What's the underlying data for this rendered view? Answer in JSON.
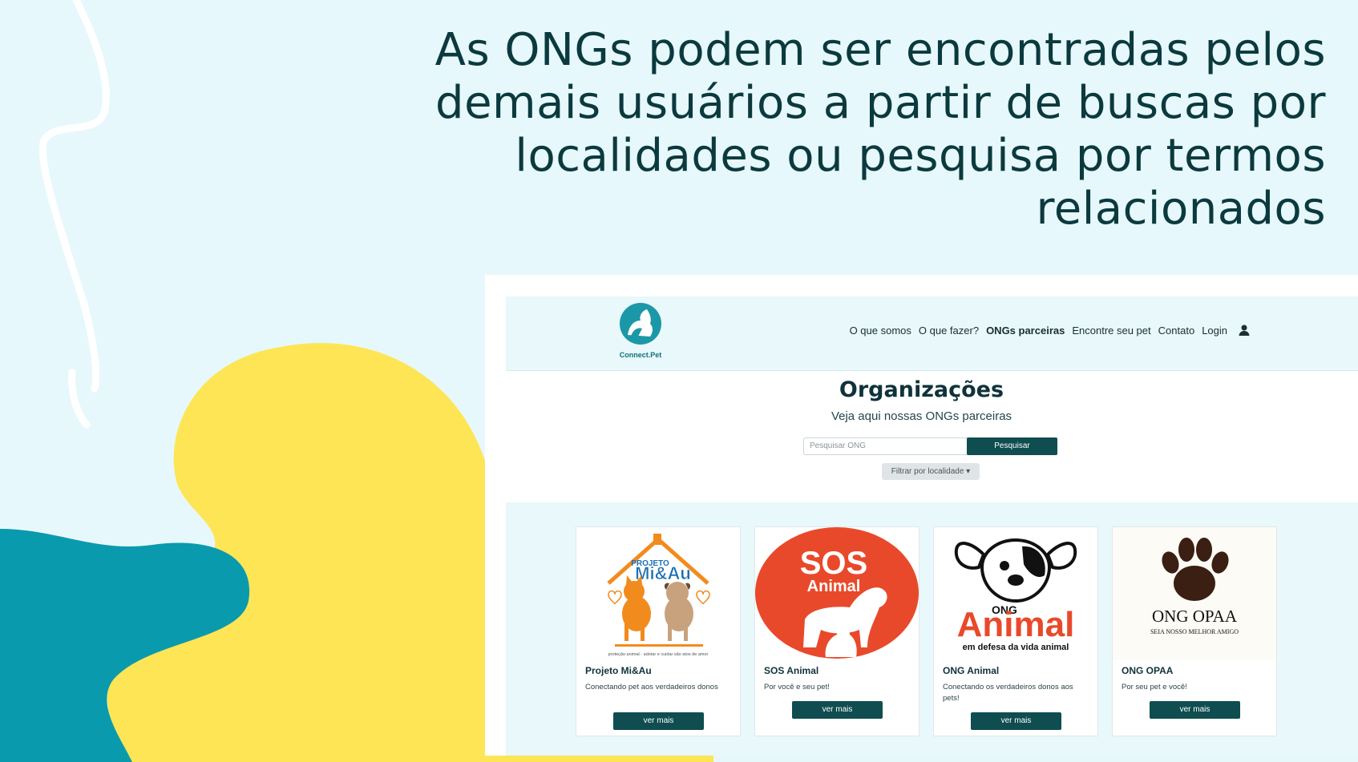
{
  "headline": "As ONGs podem ser encontradas pelos demais usuários a partir de buscas por localidades ou pesquisa por termos relacionados",
  "colors": {
    "background": "#e7f8fc",
    "teal_blob": "#0a9aae",
    "yellow_blob": "#fde556",
    "headline_text": "#0b3a3e",
    "button": "#0f4d50"
  },
  "app": {
    "logo_text": "Connect.Pet",
    "nav": {
      "items": [
        "O que somos",
        "O que fazer?",
        "ONGs parceiras",
        "Encontre seu pet",
        "Contato",
        "Login"
      ],
      "active": "ONGs parceiras",
      "user_icon": "user-icon"
    },
    "page_title": "Organizações",
    "page_subtitle": "Veja aqui nossas ONGs parceiras",
    "search": {
      "placeholder": "Pesquisar ONG",
      "button_label": "Pesquisar"
    },
    "filter_label": "Filtrar por localidade ▾",
    "cards": [
      {
        "title": "Projeto Mi&Au",
        "description": "Conectando pet aos verdadeiros donos",
        "button_label": "ver mais",
        "logo_lines": [
          "PROJETO",
          "Mi&Au",
          "proteção animal - adotar e cuidar são atos de amor"
        ]
      },
      {
        "title": "SOS Animal",
        "description": "Por você e seu pet!",
        "button_label": "ver mais",
        "logo_lines": [
          "SOS",
          "Animal"
        ]
      },
      {
        "title": "ONG Animal",
        "description": "Conectando os verdadeiros donos aos pets!",
        "button_label": "ver mais",
        "logo_lines": [
          "ONG",
          "Animal",
          "em defesa da vida animal"
        ]
      },
      {
        "title": "ONG OPAA",
        "description": "Por seu pet e você!",
        "button_label": "ver mais",
        "logo_lines": [
          "ONG OPAA",
          "SEIA NOSSO MELHOR AMIGO"
        ]
      }
    ]
  }
}
